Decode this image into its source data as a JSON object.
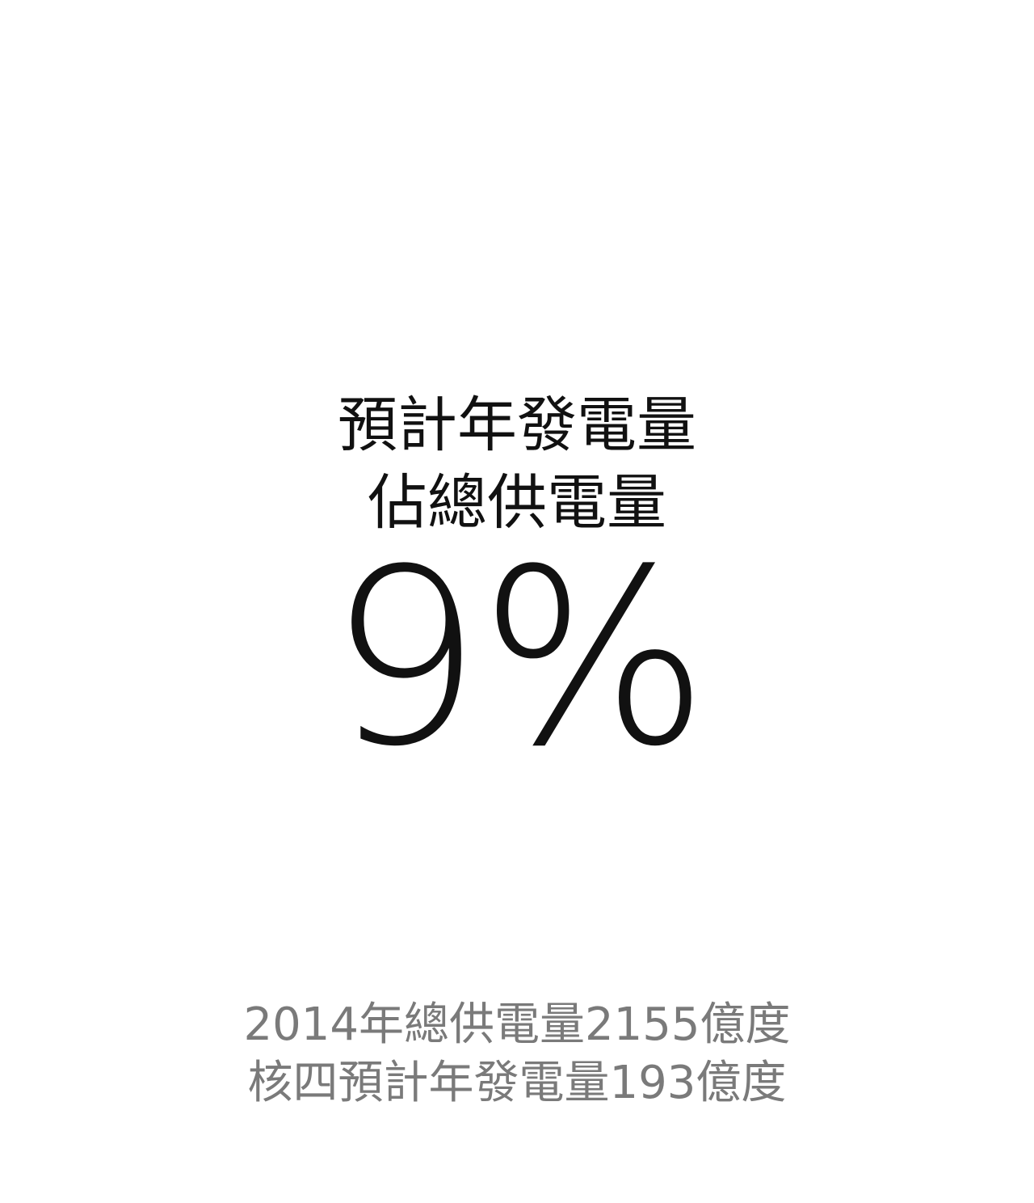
{
  "headline": {
    "line1": "預計年發電量",
    "line2": "佔總供電量"
  },
  "value": {
    "percent": "9%"
  },
  "footnote": {
    "line1": "2014年總供電量2155億度",
    "line2": "核四預計年發電量193億度"
  },
  "colors": {
    "background": "#ffffff",
    "primary_text": "#111111",
    "secondary_text": "#7a7a7a"
  }
}
